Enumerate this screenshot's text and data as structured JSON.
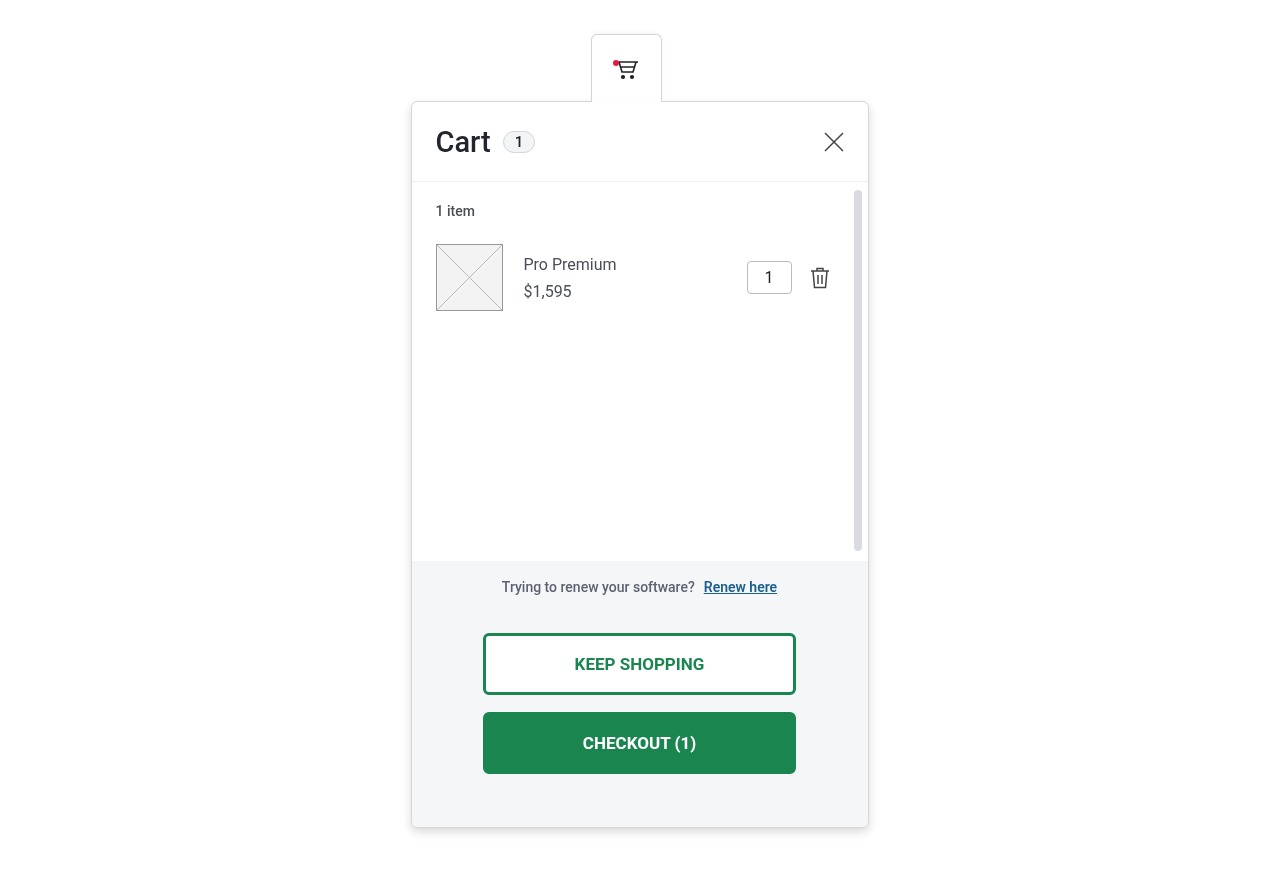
{
  "cart_tab": {
    "notification": true
  },
  "header": {
    "title": "Cart",
    "count": "1"
  },
  "item_count": "1 item",
  "items": [
    {
      "name": "Pro Premium",
      "price": "$1,595",
      "quantity": "1"
    }
  ],
  "footer": {
    "prompt": "Trying to renew your software?",
    "link": "Renew here",
    "buttons": [
      {
        "label": "KEEP SHOPPING",
        "kind": "outline"
      },
      {
        "label": "CHECKOUT (1)",
        "kind": "primary"
      }
    ]
  }
}
